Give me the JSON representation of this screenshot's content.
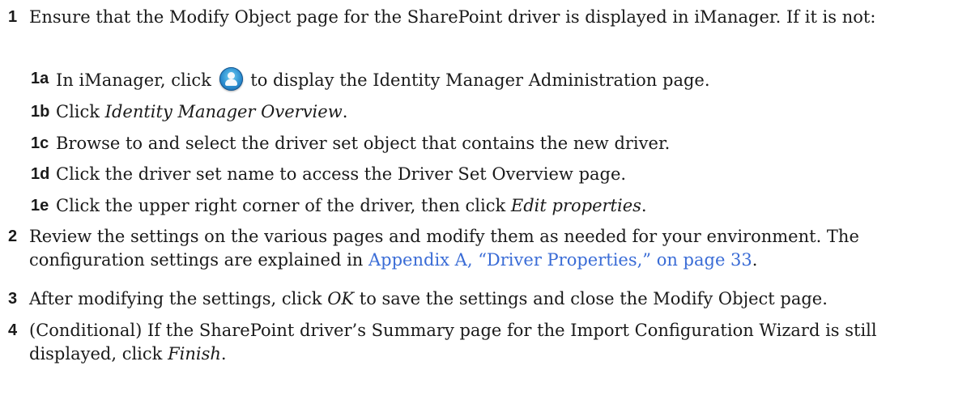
{
  "steps": [
    {
      "num": "1",
      "text": "Ensure that the Modify Object page for the SharePoint driver is displayed in iManager. If it is not:",
      "substeps": [
        {
          "num": "1a",
          "before": "In iManager, click",
          "icon": "identity-manager-administration-icon",
          "after": "to display the Identity Manager Administration page."
        },
        {
          "num": "1b",
          "before": "Click ",
          "italic": "Identity Manager Overview",
          "after": "."
        },
        {
          "num": "1c",
          "text": "Browse to and select the driver set object that contains the new driver."
        },
        {
          "num": "1d",
          "text": "Click the driver set name to access the Driver Set Overview page."
        },
        {
          "num": "1e",
          "before": "Click the upper right corner of the driver, then click ",
          "italic": "Edit properties",
          "after": "."
        }
      ]
    },
    {
      "num": "2",
      "before": "Review the settings on the various pages and modify them as needed for your environment. The configuration settings are explained in ",
      "link": "Appendix A, “Driver Properties,” on page 33",
      "after": "."
    },
    {
      "num": "3",
      "before": "After modifying the settings, click ",
      "italic": "OK",
      "after": " to save the settings and close the Modify Object page."
    },
    {
      "num": "4",
      "before": "(Conditional) If the SharePoint driver’s Summary page for the Import Configuration Wizard is still displayed, click ",
      "italic": "Finish",
      "after": "."
    }
  ],
  "colors": {
    "text": "#1a1a1a",
    "link": "#3a6cd6"
  }
}
